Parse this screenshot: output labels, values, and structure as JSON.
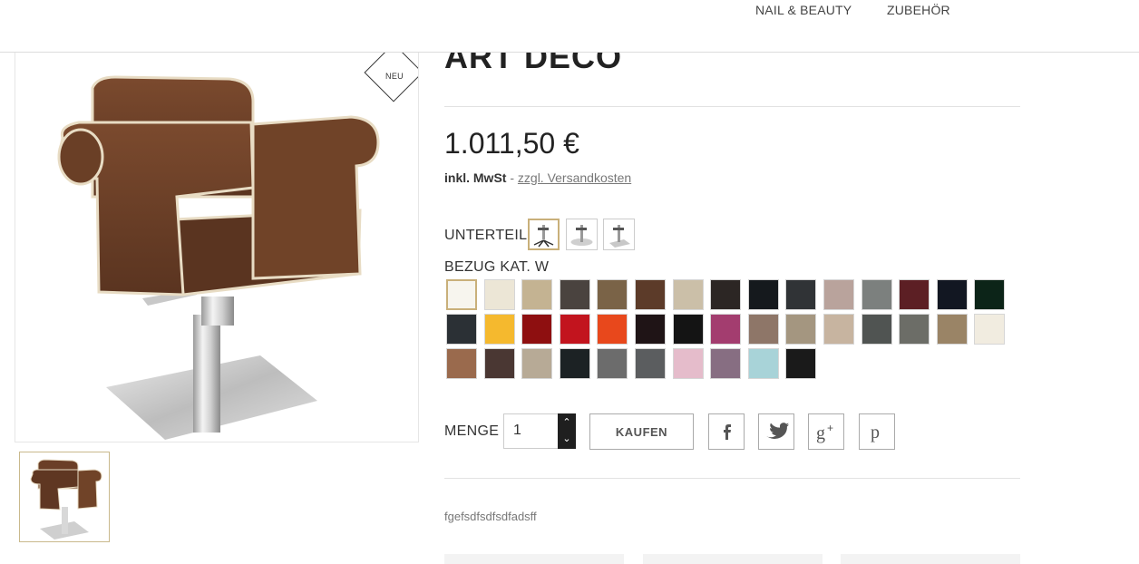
{
  "nav": {
    "items": [
      "NAIL & BEAUTY",
      "ZUBEHÖR"
    ]
  },
  "badge": {
    "label": "NEU"
  },
  "product": {
    "title": "ART DECO",
    "price": "1.011,50 €",
    "tax_label": "inkl. MwSt",
    "tax_separator": " - ",
    "shipping_link": "zzgl. Versandkosten"
  },
  "options": {
    "base_label": "UNTERTEIL",
    "base_icons": [
      "star-base-icon",
      "round-base-icon",
      "square-base-icon"
    ],
    "cover_label": "BEZUG KAT. W",
    "swatches": [
      "#f7f5ee",
      "#ece6d6",
      "#c4b392",
      "#4a433f",
      "#7a6347",
      "#5c3b29",
      "#cbbfa8",
      "#2c2624",
      "#15191d",
      "#303336",
      "#b9a39c",
      "#7c807e",
      "#5c1f24",
      "#121722",
      "#0c2418",
      "#2b3035",
      "#f5b92e",
      "#8e0f10",
      "#c2141e",
      "#e8481c",
      "#1f1416",
      "#141414",
      "#a33d6f",
      "#8e7668",
      "#a49680",
      "#c7b4a0",
      "#505452",
      "#6c6d67",
      "#9a8466",
      "#f1ece0",
      "#9a6a4d",
      "#4a3733",
      "#b7aa96",
      "#1c2224",
      "#6c6c6c",
      "#5b5d5f",
      "#e5bccb",
      "#876e82",
      "#a8d3d8",
      "#1a1a1a"
    ]
  },
  "quantity": {
    "label": "MENGE",
    "value": "1"
  },
  "actions": {
    "buy_label": "KAUFEN"
  },
  "social": [
    "facebook-icon",
    "twitter-icon",
    "google-plus-icon",
    "pinterest-icon"
  ],
  "description": "fgefsdfsdfsdfadsff",
  "colors": {
    "accent": "#c9b07a",
    "chair": "#6b3f27",
    "piping": "#e8dcc4"
  }
}
